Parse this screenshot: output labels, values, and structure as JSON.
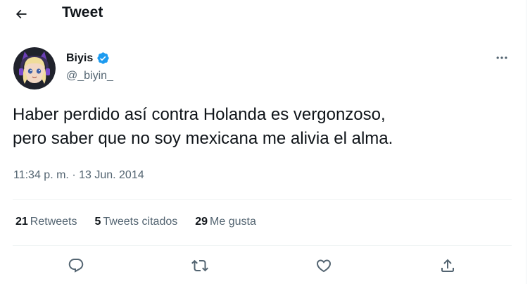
{
  "header": {
    "title": "Tweet",
    "back_icon": "arrow-left-icon"
  },
  "author": {
    "name": "Biyis",
    "handle": "@_biyin_",
    "verified": true,
    "verified_color": "#1d9bf0"
  },
  "tweet": {
    "line1": "Haber perdido así contra Holanda es vergonzoso,",
    "line2": "pero saber que no soy mexicana me alivia el alma.",
    "time": "11:34 p. m.",
    "separator": "·",
    "date": "13 Jun. 2014"
  },
  "stats": {
    "retweets_count": "21",
    "retweets_label": "Retweets",
    "quotes_count": "5",
    "quotes_label": "Tweets citados",
    "likes_count": "29",
    "likes_label": "Me gusta"
  },
  "actions": [
    "reply-icon",
    "retweet-icon",
    "like-icon",
    "share-icon"
  ],
  "colors": {
    "text": "#0f1419",
    "secondary": "#536471",
    "divider": "#eff3f4"
  }
}
